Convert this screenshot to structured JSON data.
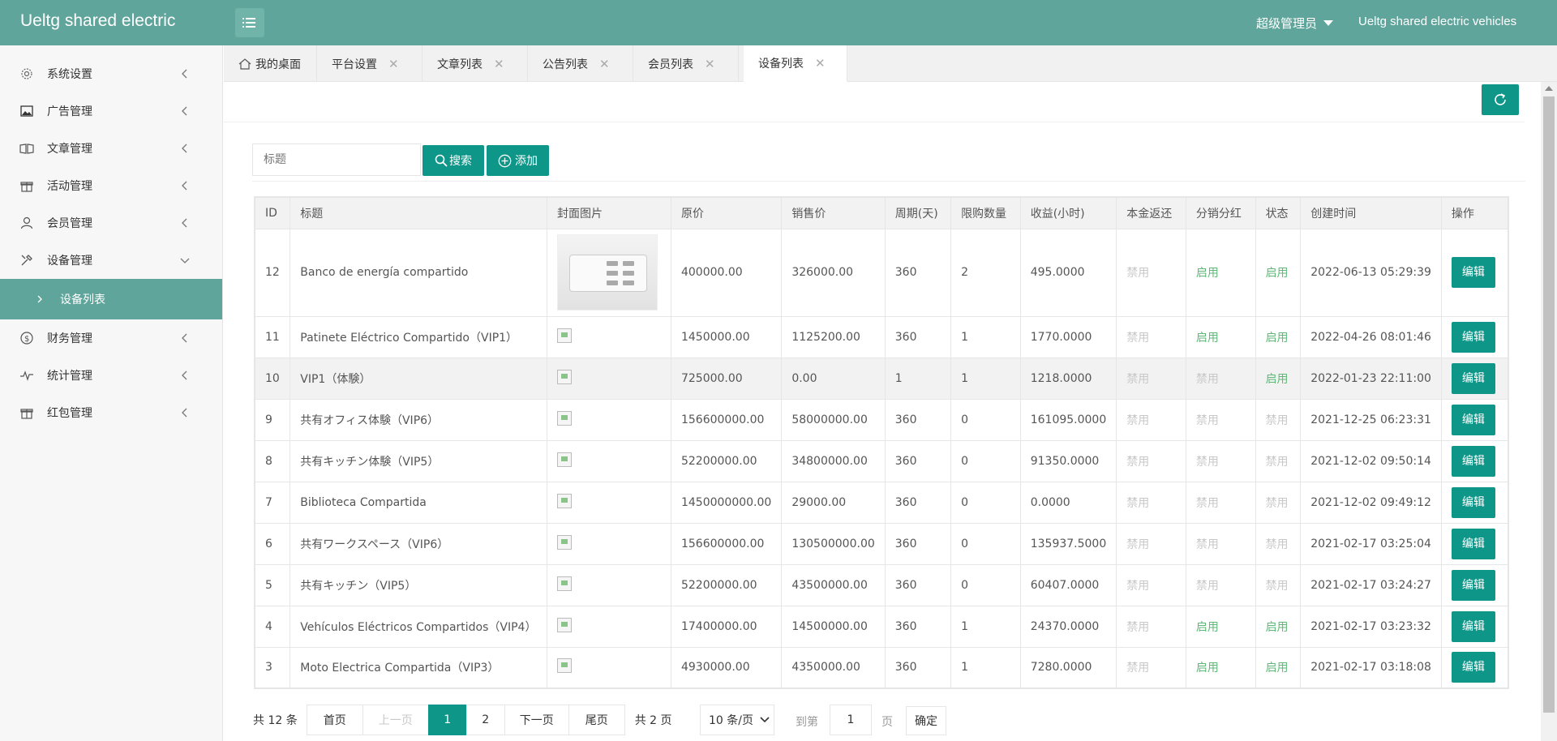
{
  "header": {
    "logo": "Ueltg shared electric",
    "user": "超级管理员",
    "brand": "Ueltg shared electric vehicles"
  },
  "sidebar": {
    "items": [
      {
        "label": "系统设置",
        "icon": "gear-icon"
      },
      {
        "label": "广告管理",
        "icon": "image-icon"
      },
      {
        "label": "文章管理",
        "icon": "book-icon"
      },
      {
        "label": "活动管理",
        "icon": "gift-icon"
      },
      {
        "label": "会员管理",
        "icon": "user-icon"
      },
      {
        "label": "设备管理",
        "icon": "tools-icon"
      },
      {
        "label": "财务管理",
        "icon": "dollar-icon"
      },
      {
        "label": "统计管理",
        "icon": "pulse-icon"
      },
      {
        "label": "红包管理",
        "icon": "gift-icon"
      }
    ],
    "sub_item": "设备列表"
  },
  "tabs": [
    {
      "label": "我的桌面"
    },
    {
      "label": "平台设置"
    },
    {
      "label": "文章列表"
    },
    {
      "label": "公告列表"
    },
    {
      "label": "会员列表"
    },
    {
      "label": "设备列表"
    }
  ],
  "search": {
    "placeholder": "标题",
    "search_label": "搜索",
    "add_label": "添加"
  },
  "table": {
    "headers": [
      "ID",
      "标题",
      "封面图片",
      "原价",
      "销售价",
      "周期(天)",
      "限购数量",
      "收益(小时)",
      "本金返还",
      "分销分红",
      "状态",
      "创建时间",
      "操作"
    ],
    "edit_label": "编辑",
    "rows": [
      {
        "id": "12",
        "title": "Banco de energía compartido",
        "orig": "400000.00",
        "sale": "326000.00",
        "cycle": "360",
        "limit": "2",
        "income": "495.0000",
        "refund": "禁用",
        "dist": "启用",
        "status": "启用",
        "created": "2022-06-13 05:29:39"
      },
      {
        "id": "11",
        "title": "Patinete Eléctrico Compartido（VIP1）",
        "orig": "1450000.00",
        "sale": "1125200.00",
        "cycle": "360",
        "limit": "1",
        "income": "1770.0000",
        "refund": "禁用",
        "dist": "启用",
        "status": "启用",
        "created": "2022-04-26 08:01:46"
      },
      {
        "id": "10",
        "title": "VIP1（体験）",
        "orig": "725000.00",
        "sale": "0.00",
        "cycle": "1",
        "limit": "1",
        "income": "1218.0000",
        "refund": "禁用",
        "dist": "禁用",
        "status": "启用",
        "created": "2022-01-23 22:11:00"
      },
      {
        "id": "9",
        "title": "共有オフィス体験（VIP6）",
        "orig": "156600000.00",
        "sale": "58000000.00",
        "cycle": "360",
        "limit": "0",
        "income": "161095.0000",
        "refund": "禁用",
        "dist": "禁用",
        "status": "禁用",
        "created": "2021-12-25 06:23:31"
      },
      {
        "id": "8",
        "title": "共有キッチン体験（VIP5）",
        "orig": "52200000.00",
        "sale": "34800000.00",
        "cycle": "360",
        "limit": "0",
        "income": "91350.0000",
        "refund": "禁用",
        "dist": "禁用",
        "status": "禁用",
        "created": "2021-12-02 09:50:14"
      },
      {
        "id": "7",
        "title": "Biblioteca Compartida",
        "orig": "1450000000.00",
        "sale": "29000.00",
        "cycle": "360",
        "limit": "0",
        "income": "0.0000",
        "refund": "禁用",
        "dist": "禁用",
        "status": "禁用",
        "created": "2021-12-02 09:49:12"
      },
      {
        "id": "6",
        "title": "共有ワークスペース（VIP6）",
        "orig": "156600000.00",
        "sale": "130500000.00",
        "cycle": "360",
        "limit": "0",
        "income": "135937.5000",
        "refund": "禁用",
        "dist": "禁用",
        "status": "禁用",
        "created": "2021-02-17 03:25:04"
      },
      {
        "id": "5",
        "title": "共有キッチン（VIP5）",
        "orig": "52200000.00",
        "sale": "43500000.00",
        "cycle": "360",
        "limit": "0",
        "income": "60407.0000",
        "refund": "禁用",
        "dist": "禁用",
        "status": "禁用",
        "created": "2021-02-17 03:24:27"
      },
      {
        "id": "4",
        "title": "Vehículos Eléctricos Compartidos（VIP4）",
        "orig": "17400000.00",
        "sale": "14500000.00",
        "cycle": "360",
        "limit": "1",
        "income": "24370.0000",
        "refund": "禁用",
        "dist": "启用",
        "status": "启用",
        "created": "2021-02-17 03:23:32"
      },
      {
        "id": "3",
        "title": "Moto Electrica Compartida（VIP3）",
        "orig": "4930000.00",
        "sale": "4350000.00",
        "cycle": "360",
        "limit": "1",
        "income": "7280.0000",
        "refund": "禁用",
        "dist": "启用",
        "status": "启用",
        "created": "2021-02-17 03:18:08"
      }
    ]
  },
  "pager": {
    "total": "共 12 条",
    "first": "首页",
    "prev": "上一页",
    "page1": "1",
    "page2": "2",
    "next": "下一页",
    "last": "尾页",
    "pages": "共 2 页",
    "size": "10 条/页",
    "goto": "到第",
    "goto_value": "1",
    "page_unit": "页",
    "ok": "确定"
  },
  "colors": {
    "primary": "#0e9688",
    "header": "#5fa59b",
    "enabled": "#5fb878",
    "disabled": "#c8c8c8"
  }
}
